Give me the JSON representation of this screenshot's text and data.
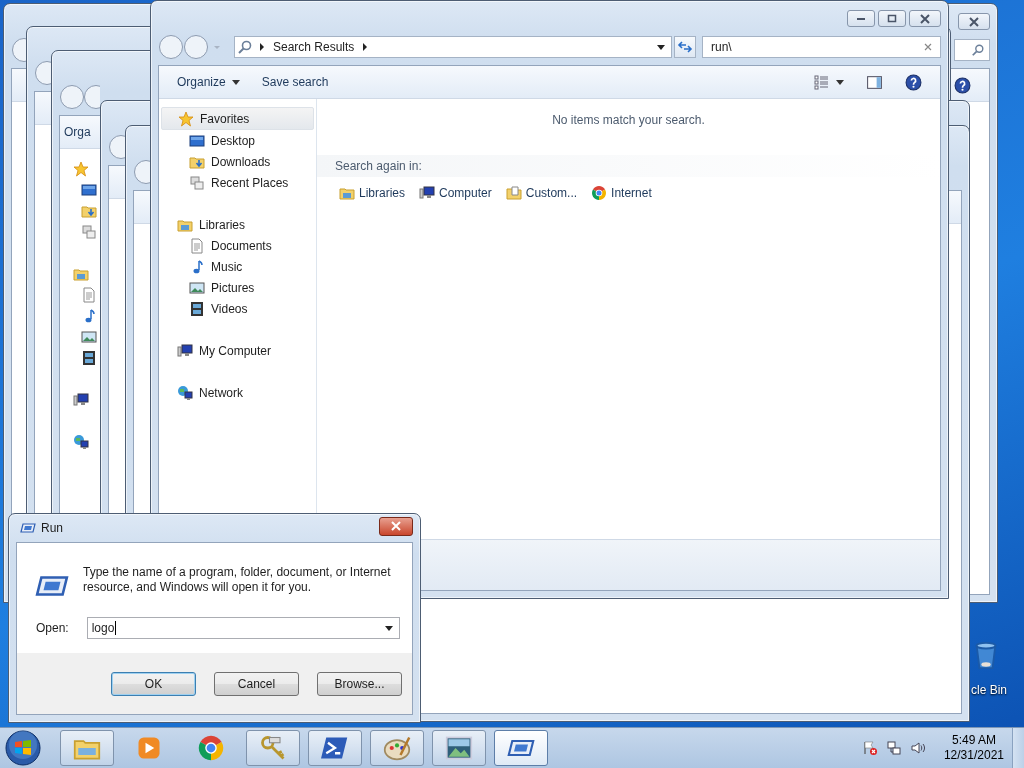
{
  "desktop": {
    "recycle_bin_label": "cle Bin"
  },
  "background_windows": [
    {
      "kind": "explorer"
    },
    {
      "kind": "explorer"
    },
    {
      "kind": "explorer",
      "toolbar_label": "Orga"
    },
    {
      "kind": "explorer"
    },
    {
      "kind": "explorer"
    }
  ],
  "explorer": {
    "breadcrumb": "Search Results",
    "search": {
      "value": "run\\"
    },
    "toolbar": [
      {
        "label": "Organize",
        "kind": "menu"
      },
      {
        "label": "Save search",
        "kind": "plain"
      }
    ],
    "navigation": [
      {
        "label": "Favorites",
        "kind": "star",
        "selected": true,
        "children": [
          {
            "label": "Desktop",
            "kind": "desktop",
            "selected": false
          },
          {
            "label": "Downloads",
            "kind": "downloads",
            "selected": false
          },
          {
            "label": "Recent Places",
            "kind": "recent",
            "selected": false
          }
        ]
      },
      {
        "label": "Libraries",
        "kind": "libraries",
        "selected": false,
        "children": [
          {
            "label": "Documents",
            "kind": "documents",
            "selected": false
          },
          {
            "label": "Music",
            "kind": "music",
            "selected": false
          },
          {
            "label": "Pictures",
            "kind": "pictures",
            "selected": false
          },
          {
            "label": "Videos",
            "kind": "videos",
            "selected": false
          }
        ]
      },
      {
        "label": "My Computer",
        "kind": "computer",
        "selected": false
      },
      {
        "label": "Network",
        "kind": "network",
        "selected": false
      }
    ],
    "message": "No items match your search.",
    "search_again": {
      "label": "Search again in:",
      "locations": [
        {
          "label": "Libraries",
          "kind": "libraries"
        },
        {
          "label": "Computer",
          "kind": "computer"
        },
        {
          "label": "Custom...",
          "kind": "custom"
        },
        {
          "label": "Internet",
          "kind": "chrome"
        }
      ]
    }
  },
  "run_dialog": {
    "title": "Run",
    "instruction": "Type the name of a program, folder, document, or Internet resource, and Windows will open it for you.",
    "open_label": "Open:",
    "value": "logo",
    "buttons": [
      {
        "label": "OK",
        "default": true
      },
      {
        "label": "Cancel",
        "default": false
      },
      {
        "label": "Browse...",
        "default": false
      }
    ]
  },
  "taskbar": {
    "items": [
      {
        "kind": "explorer",
        "running": true,
        "selected": false
      },
      {
        "kind": "media",
        "running": false,
        "selected": false
      },
      {
        "kind": "chrome",
        "running": false,
        "selected": false
      },
      {
        "kind": "keys",
        "running": true,
        "selected": false
      },
      {
        "kind": "powershell",
        "running": true,
        "selected": false
      },
      {
        "kind": "paint",
        "running": true,
        "selected": false
      },
      {
        "kind": "photo",
        "running": true,
        "selected": false
      },
      {
        "kind": "run",
        "running": true,
        "selected": true
      }
    ],
    "time": "5:49 AM",
    "date": "12/31/2021"
  }
}
